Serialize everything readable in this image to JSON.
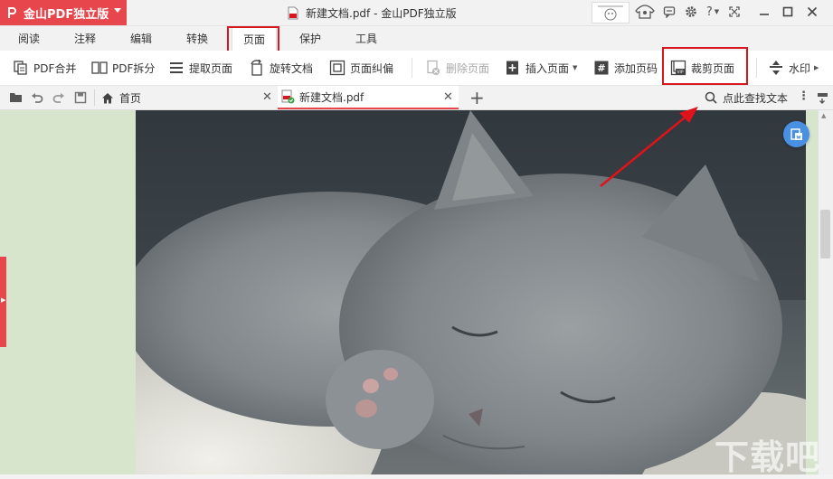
{
  "app": {
    "brand_name": "金山PDF独立版",
    "window_title": "新建文档.pdf - 金山PDF独立版"
  },
  "menu_tabs": [
    {
      "label": "阅读"
    },
    {
      "label": "注释"
    },
    {
      "label": "编辑"
    },
    {
      "label": "转换"
    },
    {
      "label": "页面",
      "active": true
    },
    {
      "label": "保护"
    },
    {
      "label": "工具"
    }
  ],
  "toolbar": {
    "merge": "PDF合并",
    "split": "PDF拆分",
    "extract": "提取页面",
    "rotate": "旋转文档",
    "deskew": "页面纠偏",
    "delete": "删除页面",
    "insert": "插入页面",
    "add_page_number": "添加页码",
    "crop": "裁剪页面",
    "watermark": "水印"
  },
  "doc_tabs": {
    "home": "首页",
    "file": "新建文档.pdf",
    "search_label": "点此查找文本"
  },
  "watermark_text": "下载吧",
  "colors": {
    "accent_red": "#e8464d",
    "highlight_red": "#d6171f",
    "page_bg": "#d7e5cc",
    "fab_blue": "#4a90e2"
  },
  "icons": [
    "pdf-logo-icon",
    "pdf-document-icon",
    "avatar-icon",
    "skin-icon",
    "message-icon",
    "settings-icon",
    "help-icon",
    "fullscreen-icon",
    "minimize-icon",
    "maximize-icon",
    "close-icon",
    "open-folder-icon",
    "undo-icon",
    "redo-icon",
    "save-icon",
    "home-icon",
    "search-icon",
    "more-icon",
    "thumbnail-icon",
    "add-tab-icon"
  ]
}
